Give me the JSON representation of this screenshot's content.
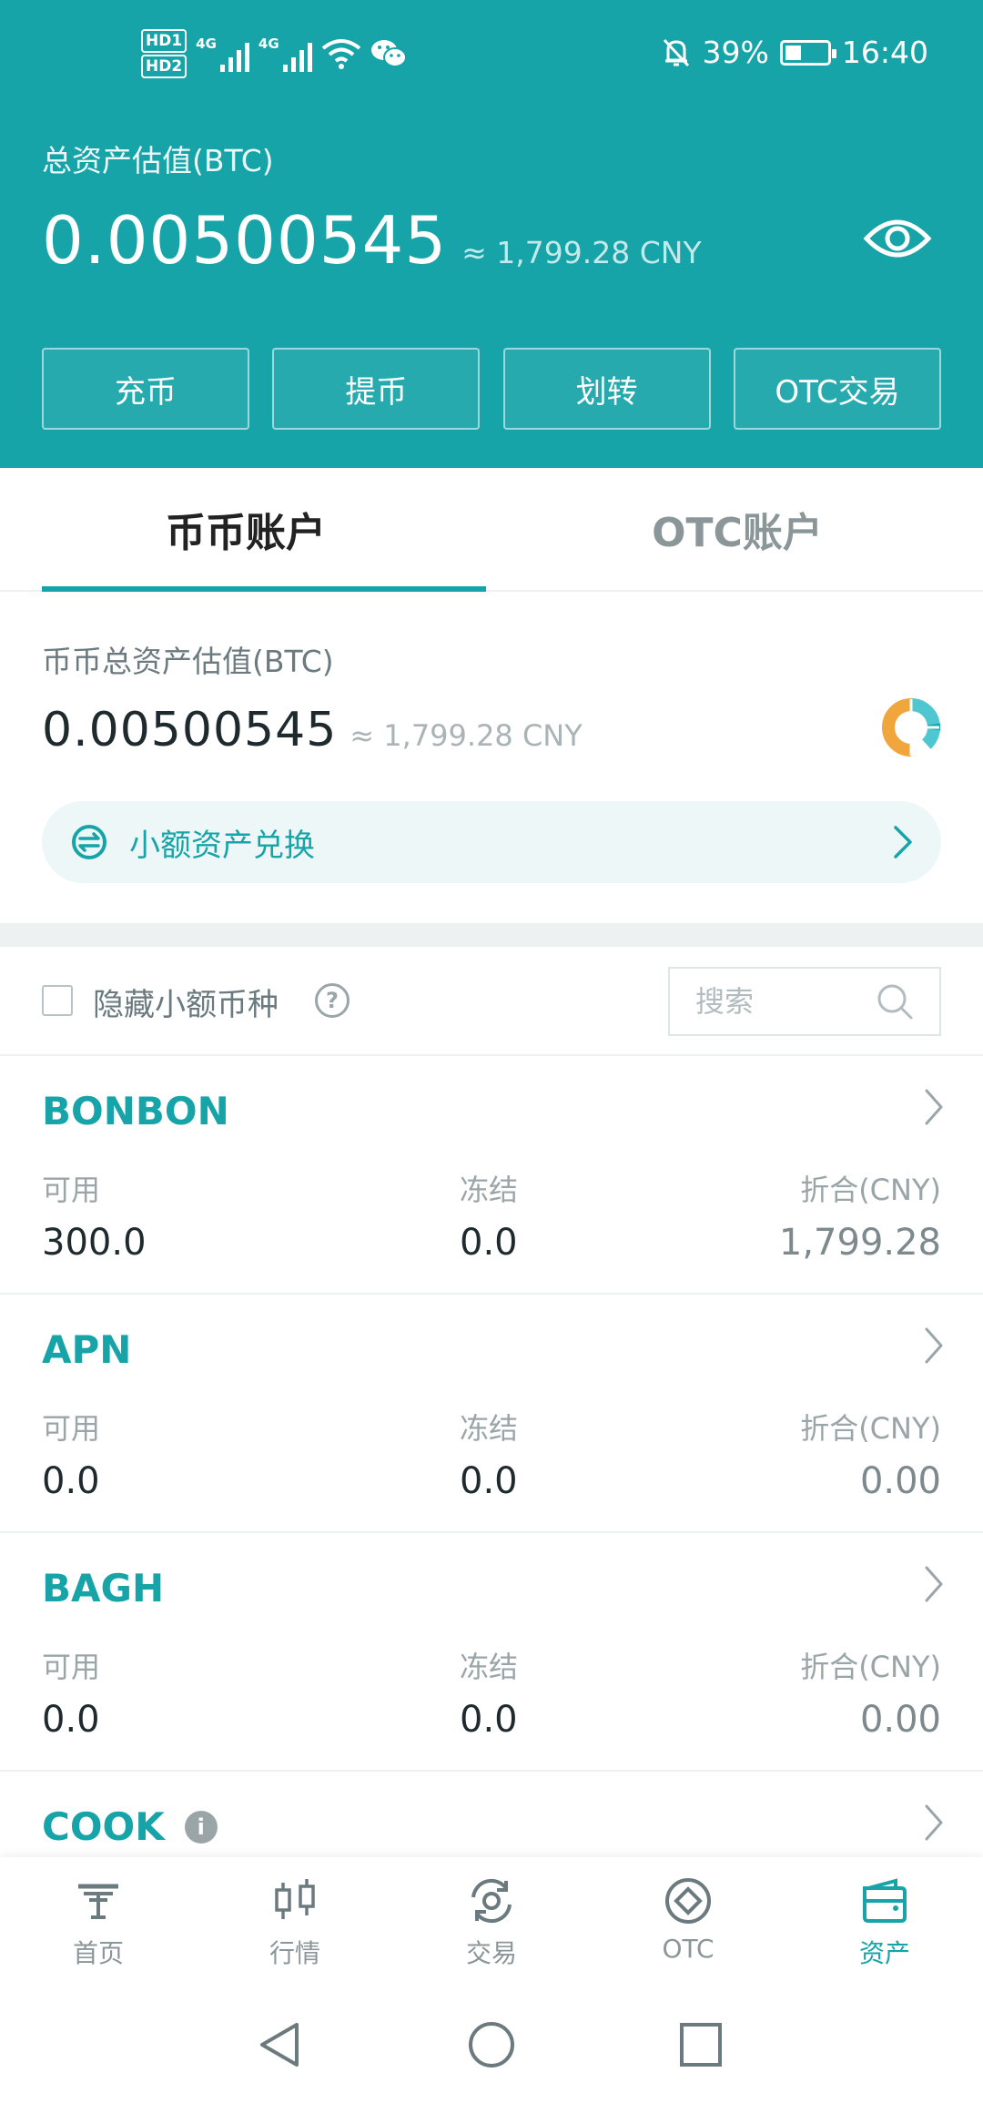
{
  "status_bar": {
    "hd1": "HD1",
    "hd2": "HD2",
    "net1": "4G",
    "net2": "4G",
    "battery_percent": "39%",
    "battery_level": 0.39,
    "time": "16:40",
    "icons": [
      "signal-icon",
      "wifi-icon",
      "wechat-icon",
      "bell-off-icon",
      "battery-icon"
    ]
  },
  "header": {
    "total_label": "总资产估值(BTC)",
    "total_btc": "0.00500545",
    "total_cny": "≈ 1,799.28 CNY",
    "actions": [
      "充币",
      "提币",
      "划转",
      "OTC交易"
    ]
  },
  "tabs": [
    "币币账户",
    "OTC账户"
  ],
  "account": {
    "label": "币币总资产估值(BTC)",
    "btc": "0.00500545",
    "cny": "≈ 1,799.28 CNY",
    "exchange_label": "小额资产兑换"
  },
  "filter": {
    "hide_small_label": "隐藏小额币种",
    "search_placeholder": "搜索"
  },
  "coins": [
    {
      "name": "BONBON",
      "available_label": "可用",
      "available": "300.0",
      "frozen_label": "冻结",
      "frozen": "0.0",
      "value_label": "折合(CNY)",
      "value": "1,799.28"
    },
    {
      "name": "APN",
      "available_label": "可用",
      "available": "0.0",
      "frozen_label": "冻结",
      "frozen": "0.0",
      "value_label": "折合(CNY)",
      "value": "0.00"
    },
    {
      "name": "BAGH",
      "available_label": "可用",
      "available": "0.0",
      "frozen_label": "冻结",
      "frozen": "0.0",
      "value_label": "折合(CNY)",
      "value": "0.00"
    },
    {
      "name": "COOK",
      "info": "i"
    }
  ],
  "bottom_nav": [
    "首页",
    "行情",
    "交易",
    "OTC",
    "资产"
  ],
  "colors": {
    "primary": "#17a4a8",
    "donut_orange": "#f0a63c",
    "donut_teal": "#4fc7d0"
  }
}
